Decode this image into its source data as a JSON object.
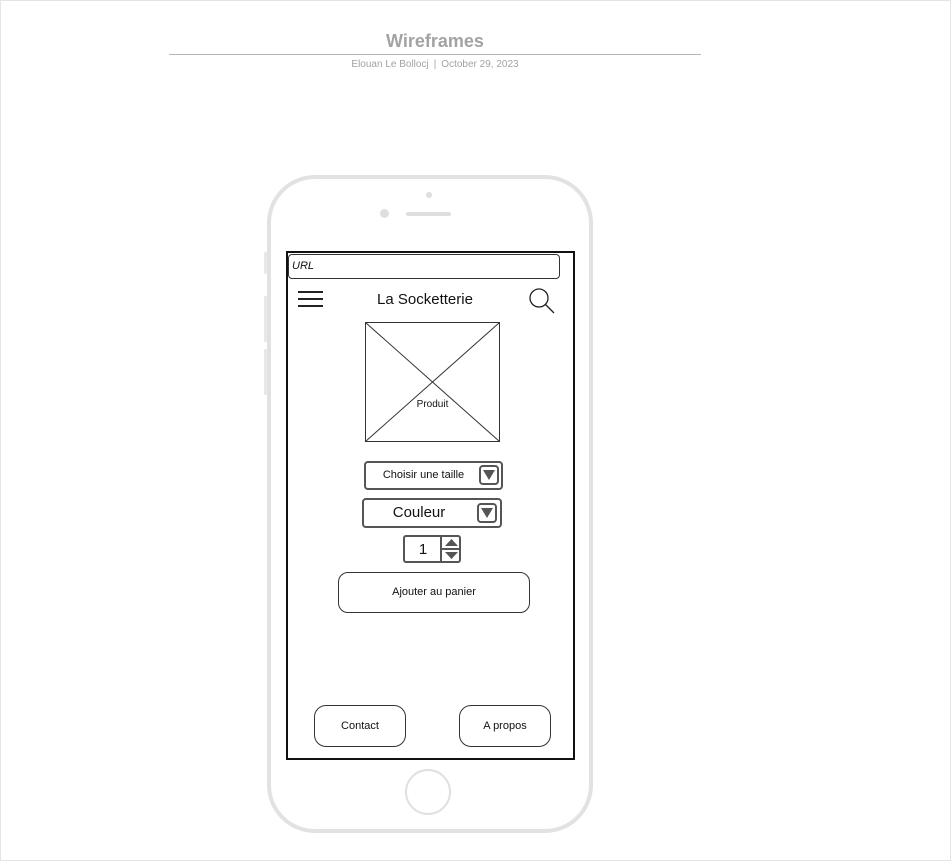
{
  "document": {
    "title": "Wireframes",
    "author": "Elouan Le Bollocj",
    "separator": "|",
    "date": "October 29, 2023"
  },
  "browser": {
    "url_label": "URL"
  },
  "header": {
    "menu_icon": "hamburger-menu-icon",
    "title": "La Socketterie",
    "search_icon": "magnifier-icon"
  },
  "product": {
    "image_label": "Produit"
  },
  "options": {
    "size_placeholder": "Choisir une taille",
    "color_placeholder": "Couleur",
    "quantity": "1"
  },
  "actions": {
    "add_to_cart": "Ajouter au panier"
  },
  "footer": {
    "contact": "Contact",
    "about": "A propos"
  }
}
